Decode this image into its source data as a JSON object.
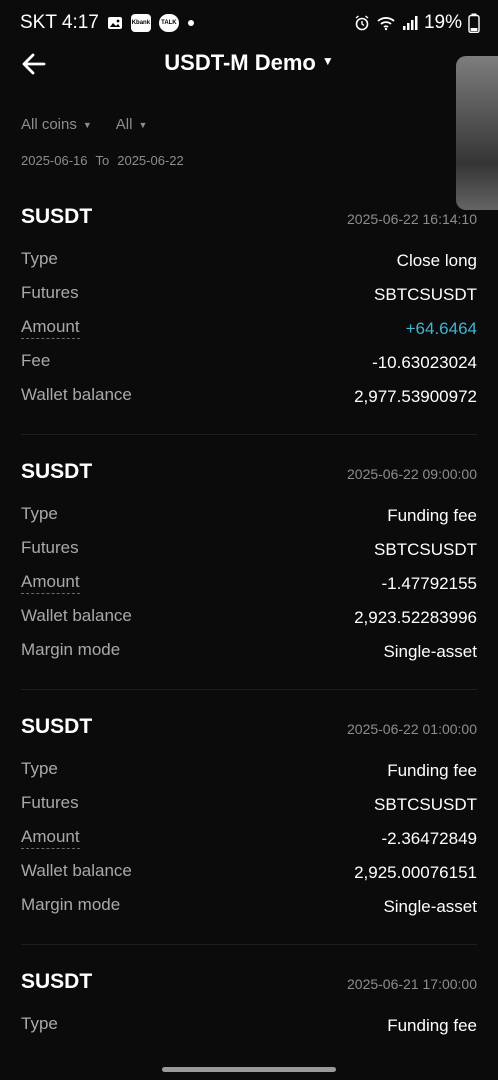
{
  "status_bar": {
    "carrier_time": "SKT 4:17",
    "apps": [
      "Kbank",
      "TALK"
    ],
    "battery": "19%"
  },
  "header": {
    "title": "USDT-M Demo"
  },
  "filters": {
    "coins": "All coins",
    "type": "All"
  },
  "date_range": {
    "from": "2025-06-16",
    "to_label": "To",
    "to": "2025-06-22"
  },
  "records": [
    {
      "coin": "SUSDT",
      "time": "2025-06-22 16:14:10",
      "rows": [
        {
          "label": "Type",
          "value": "Close long"
        },
        {
          "label": "Futures",
          "value": "SBTCSUSDT"
        },
        {
          "label": "Amount",
          "value": "+64.6464",
          "positive": true
        },
        {
          "label": "Fee",
          "value": "-10.63023024"
        },
        {
          "label": "Wallet balance",
          "value": "2,977.53900972"
        }
      ]
    },
    {
      "coin": "SUSDT",
      "time": "2025-06-22 09:00:00",
      "rows": [
        {
          "label": "Type",
          "value": "Funding fee"
        },
        {
          "label": "Futures",
          "value": "SBTCSUSDT"
        },
        {
          "label": "Amount",
          "value": "-1.47792155"
        },
        {
          "label": "Wallet balance",
          "value": "2,923.52283996"
        },
        {
          "label": "Margin mode",
          "value": "Single-asset"
        }
      ]
    },
    {
      "coin": "SUSDT",
      "time": "2025-06-22 01:00:00",
      "rows": [
        {
          "label": "Type",
          "value": "Funding fee"
        },
        {
          "label": "Futures",
          "value": "SBTCSUSDT"
        },
        {
          "label": "Amount",
          "value": "-2.36472849"
        },
        {
          "label": "Wallet balance",
          "value": "2,925.00076151"
        },
        {
          "label": "Margin mode",
          "value": "Single-asset"
        }
      ]
    },
    {
      "coin": "SUSDT",
      "time": "2025-06-21 17:00:00",
      "rows": [
        {
          "label": "Type",
          "value": "Funding fee"
        }
      ]
    }
  ],
  "colors": {
    "positive": "#3fb5d4",
    "muted": "#8d8d8d",
    "background": "#0b0b0b"
  }
}
